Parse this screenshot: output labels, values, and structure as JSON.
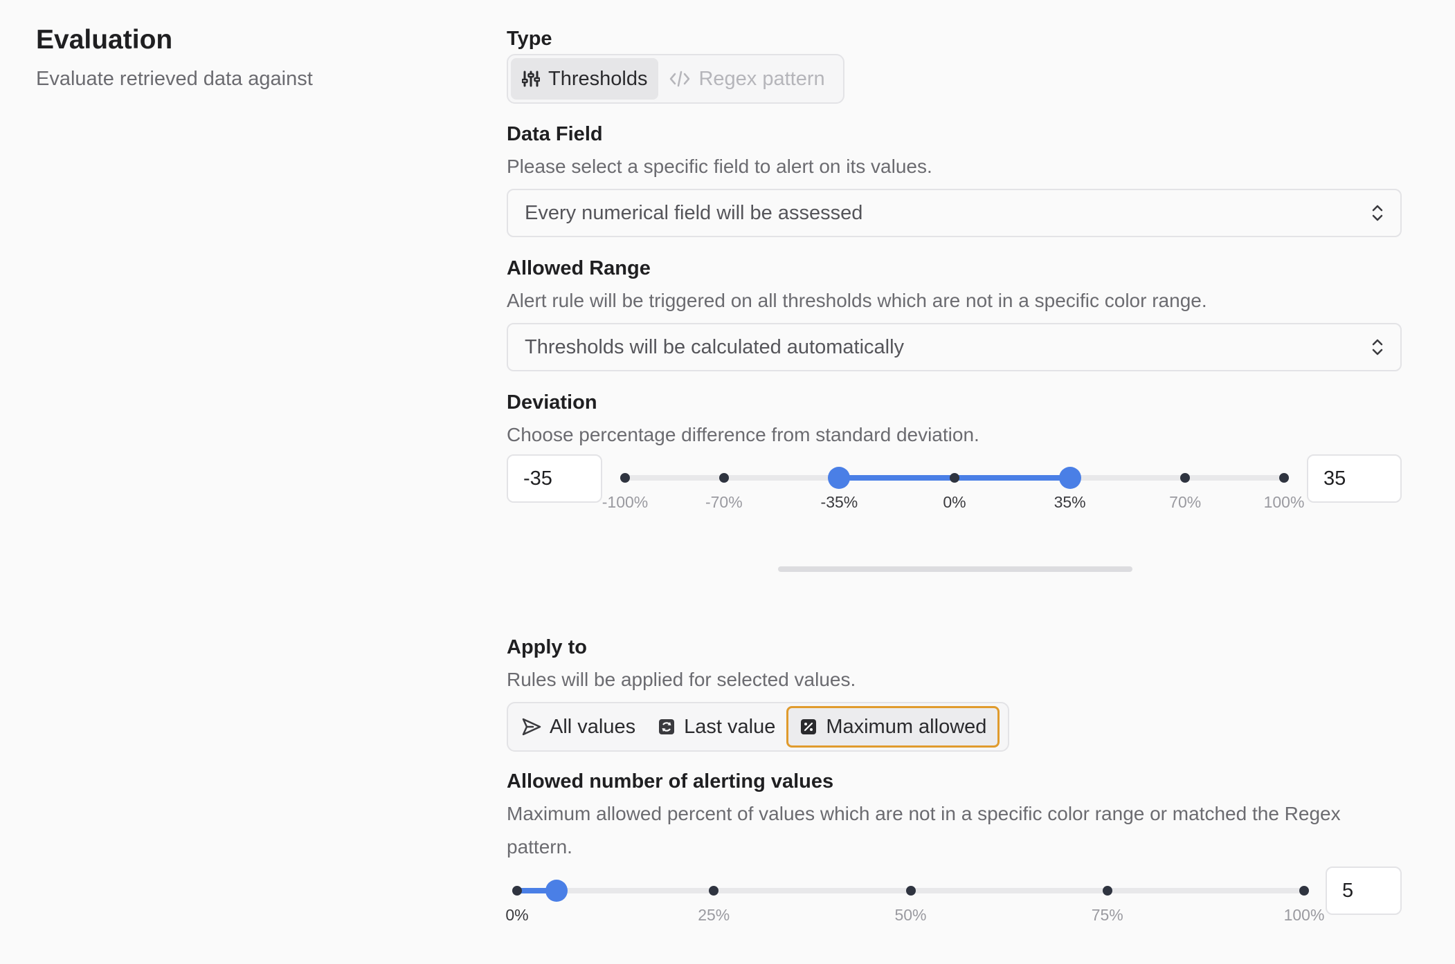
{
  "section": {
    "title": "Evaluation",
    "subtitle": "Evaluate retrieved data against"
  },
  "type": {
    "label": "Type",
    "options": [
      {
        "label": "Thresholds",
        "icon": "sliders-icon",
        "state": "active"
      },
      {
        "label": "Regex pattern",
        "icon": "code-icon",
        "state": "disabled"
      }
    ]
  },
  "data_field": {
    "label": "Data Field",
    "description": "Please select a specific field to alert on its values.",
    "selected": "Every numerical field will be assessed"
  },
  "allowed_range": {
    "label": "Allowed Range",
    "description": "Alert rule will be triggered on all thresholds which are not in a specific color range.",
    "selected": "Thresholds will be calculated automatically"
  },
  "deviation": {
    "label": "Deviation",
    "description": "Choose percentage difference from standard deviation.",
    "min_value": "-35",
    "max_value": "35",
    "range": [
      -100,
      100
    ],
    "selected_range": [
      -35,
      35
    ],
    "ticks": [
      {
        "value": -100,
        "label": "-100%"
      },
      {
        "value": -70,
        "label": "-70%"
      },
      {
        "value": -35,
        "label": "-35%"
      },
      {
        "value": 0,
        "label": "0%"
      },
      {
        "value": 35,
        "label": "35%"
      },
      {
        "value": 70,
        "label": "70%"
      },
      {
        "value": 100,
        "label": "100%"
      }
    ]
  },
  "apply_to": {
    "label": "Apply to",
    "description": "Rules will be applied for selected values.",
    "options": [
      {
        "label": "All values",
        "icon": "send-icon",
        "state": "normal"
      },
      {
        "label": "Last value",
        "icon": "refresh-square-icon",
        "state": "normal"
      },
      {
        "label": "Maximum allowed",
        "icon": "percent-square-icon",
        "state": "selected"
      }
    ]
  },
  "alerting_values": {
    "label": "Allowed number of alerting values",
    "description_line1": "Maximum allowed percent of values which are not in a specific color range or matched the Regex",
    "description_line2": "pattern.",
    "value": "5",
    "range": [
      0,
      100
    ],
    "selected": 5,
    "ticks": [
      {
        "value": 0,
        "label": "0%"
      },
      {
        "value": 25,
        "label": "25%"
      },
      {
        "value": 50,
        "label": "50%"
      },
      {
        "value": 75,
        "label": "75%"
      },
      {
        "value": 100,
        "label": "100%"
      }
    ]
  },
  "colors": {
    "accent": "#4a7fe6",
    "focus_ring": "#e09b2d"
  }
}
